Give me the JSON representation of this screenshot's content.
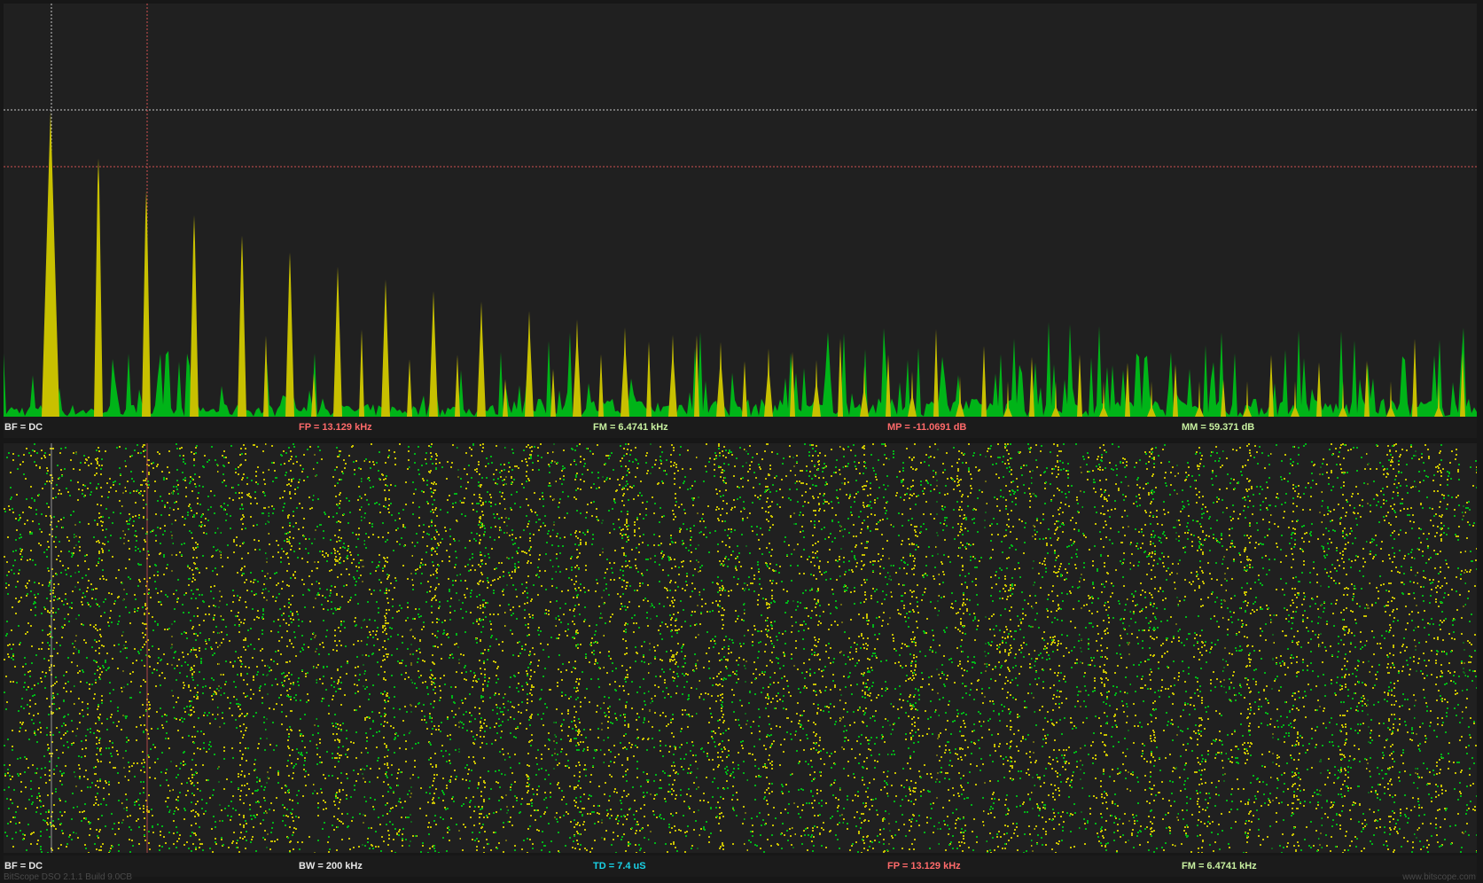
{
  "colors": {
    "label_white": "#e6e6e6",
    "label_red": "#ff6a6a",
    "label_lightgreen": "#c8f0a0",
    "label_cyan": "#19d2e6",
    "trace_yellow": "#c8c000",
    "trace_green": "#00b418",
    "cursor_white": "#c8c8c8",
    "cursor_red": "#d05050"
  },
  "spectrum_readouts": [
    {
      "text": "BF = DC",
      "color": "label_white"
    },
    {
      "text": "FP = 13.129 kHz",
      "color": "label_red"
    },
    {
      "text": "FM = 6.4741 kHz",
      "color": "label_lightgreen"
    },
    {
      "text": "MP = -11.0691 dB",
      "color": "label_red"
    },
    {
      "text": "MM = 59.371 dB",
      "color": "label_lightgreen"
    }
  ],
  "spectrogram_readouts": [
    {
      "text": "BF = DC",
      "color": "label_white"
    },
    {
      "text": "BW = 200 kHz",
      "color": "label_white"
    },
    {
      "text": "TD = 7.4 uS",
      "color": "label_cyan"
    },
    {
      "text": "FP = 13.129 kHz",
      "color": "label_red"
    },
    {
      "text": "FM = 6.4741 kHz",
      "color": "label_lightgreen"
    }
  ],
  "footer": {
    "app_build": "BitScope DSO 2.1.1 Build 9.0CB",
    "website": "www.bitscope.com"
  }
}
